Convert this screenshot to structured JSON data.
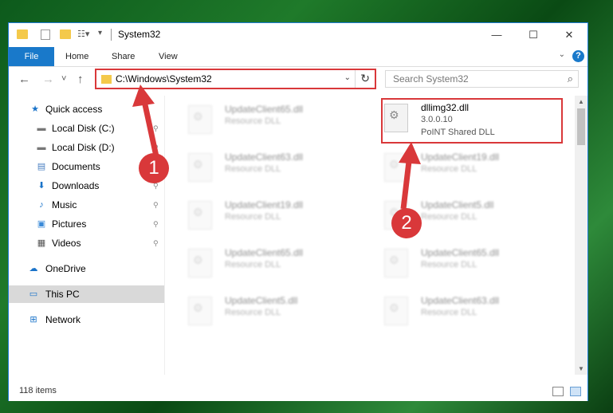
{
  "window": {
    "title": "System32",
    "controls": {
      "minimize": "—",
      "maximize": "☐",
      "close": "✕"
    }
  },
  "ribbon": {
    "tabs": [
      "File",
      "Home",
      "Share",
      "View"
    ],
    "help": "?"
  },
  "nav": {
    "back": "←",
    "forward": "→",
    "recent": "˅",
    "up": "↑"
  },
  "address": {
    "path": "C:\\Windows\\System32",
    "dropdown": "⌄",
    "refresh": "↻"
  },
  "search": {
    "placeholder": "Search System32",
    "icon": "⌕"
  },
  "sidebar": {
    "items": [
      {
        "label": "Quick access",
        "icon": "star-icon",
        "glyph": "★",
        "pinned": false
      },
      {
        "label": "Local Disk (C:)",
        "icon": "drive-icon",
        "glyph": "▬",
        "pinned": true
      },
      {
        "label": "Local Disk (D:)",
        "icon": "drive-icon",
        "glyph": "▬",
        "pinned": true
      },
      {
        "label": "Documents",
        "icon": "documents-icon",
        "glyph": "▤",
        "pinned": true
      },
      {
        "label": "Downloads",
        "icon": "download-icon",
        "glyph": "⬇",
        "pinned": true
      },
      {
        "label": "Music",
        "icon": "music-icon",
        "glyph": "♪",
        "pinned": true
      },
      {
        "label": "Pictures",
        "icon": "pictures-icon",
        "glyph": "▣",
        "pinned": true
      },
      {
        "label": "Videos",
        "icon": "videos-icon",
        "glyph": "▦",
        "pinned": true
      },
      {
        "label": "OneDrive",
        "icon": "cloud-icon",
        "glyph": "☁",
        "pinned": false
      },
      {
        "label": "This PC",
        "icon": "computer-icon",
        "glyph": "▭",
        "pinned": false
      },
      {
        "label": "Network",
        "icon": "network-icon",
        "glyph": "⊞",
        "pinned": false
      }
    ],
    "pin_glyph": "📌"
  },
  "files": {
    "highlighted": {
      "name": "dllimg32.dll",
      "version": "3.0.0.10",
      "description": "PoINT Shared DLL"
    },
    "left_column": [
      {
        "name": "UpdateClient65.dll",
        "type": "Resource DLL"
      },
      {
        "name": "UpdateClient63.dll",
        "type": "Resource DLL"
      },
      {
        "name": "UpdateClient19.dll",
        "type": "Resource DLL"
      },
      {
        "name": "UpdateClient65.dll",
        "type": "Resource DLL"
      },
      {
        "name": "UpdateClient5.dll",
        "type": "Resource DLL"
      }
    ],
    "right_column": [
      {
        "name": "UpdateClient19.dll",
        "type": "Resource DLL"
      },
      {
        "name": "UpdateClient5.dll",
        "type": "Resource DLL"
      },
      {
        "name": "UpdateClient65.dll",
        "type": "Resource DLL"
      },
      {
        "name": "UpdateClient63.dll",
        "type": "Resource DLL"
      }
    ]
  },
  "status": {
    "item_count": "118 items"
  },
  "annotations": {
    "callout_1": "1",
    "callout_2": "2",
    "accent_color": "#d9383a"
  }
}
